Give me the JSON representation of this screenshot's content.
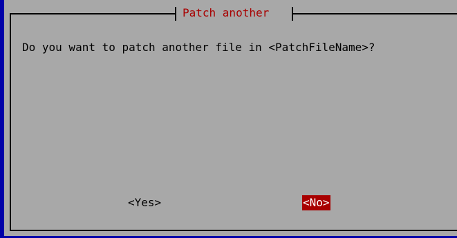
{
  "dialog": {
    "title": "Patch another",
    "message": "Do you want to patch another file in <PatchFileName>?",
    "yes_label": "<Yes>",
    "no_label": "<No>",
    "focused_button": "No"
  },
  "colors": {
    "background": "#a8a8a8",
    "terminal_edge": "#0000a8",
    "title_text": "#a80000",
    "focus_bg": "#a80000",
    "focus_text": "#ffffff"
  }
}
